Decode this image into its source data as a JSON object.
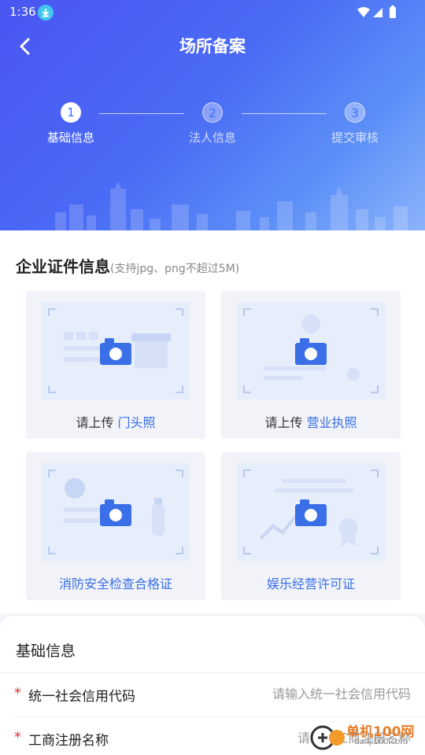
{
  "status": {
    "time": "1:36"
  },
  "nav": {
    "title": "场所备案"
  },
  "steps": [
    {
      "num": "1",
      "label": "基础信息"
    },
    {
      "num": "2",
      "label": "法人信息"
    },
    {
      "num": "3",
      "label": "提交审核"
    }
  ],
  "certificates": {
    "title": "企业证件信息",
    "hint": "(支持jpg、png不超过5M)",
    "items": [
      {
        "prefix": "请上传",
        "name": "门头照"
      },
      {
        "prefix": "请上传",
        "name": "营业执照"
      },
      {
        "prefix": "",
        "name": "消防安全检查合格证"
      },
      {
        "prefix": "",
        "name": "娱乐经营许可证"
      }
    ]
  },
  "basic": {
    "title": "基础信息",
    "fields": [
      {
        "required": "*",
        "label": "统一社会信用代码",
        "placeholder": "请输入统一社会信用代码"
      },
      {
        "required": "*",
        "label": "工商注册名称",
        "placeholder": "请输入工商注册名称"
      }
    ]
  },
  "watermark": {
    "name": "单机100网",
    "url": "danji100.com"
  },
  "colors": {
    "accent": "#3a6fe8",
    "required": "#e8333a",
    "header_start": "#4a55f2",
    "header_end": "#8db5fb"
  }
}
